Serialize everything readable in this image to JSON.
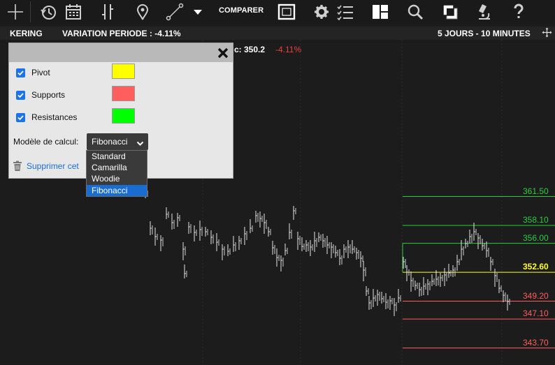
{
  "toolbar": {
    "compare_label": "COMPARER",
    "icons": [
      "crosshair-icon",
      "history-clock-icon",
      "calendar-icon",
      "candlestick-icon",
      "map-pin-icon",
      "trendline-icon",
      "chevron-down-icon",
      "fullscreen-icon",
      "gear-icon",
      "checklist-icon",
      "layout-icon",
      "search-icon",
      "color-contrast-icon",
      "microscope-icon",
      "help-icon"
    ]
  },
  "infobar": {
    "symbol": "KERING",
    "variation": "VARIATION PERIODE : -4.11%",
    "period": "5 JOURS - 10 MINUTES"
  },
  "quote": {
    "price_fragment": "c: 350.2",
    "change": "-4.11%"
  },
  "panel": {
    "rows": [
      {
        "label": "Pivot",
        "checked": true,
        "color": "#ffff00"
      },
      {
        "label": "Supports",
        "checked": true,
        "color": "#ff5e5e"
      },
      {
        "label": "Resistances",
        "checked": true,
        "color": "#00ff00"
      }
    ],
    "model_label": "Modèle de calcul:",
    "model_value": "Fibonacci",
    "delete_label": "Supprimer cet"
  },
  "dropdown": {
    "options": [
      "Standard",
      "Camarilla",
      "Woodie",
      "Fibonacci"
    ],
    "selected": "Fibonacci"
  },
  "levels": [
    {
      "value": "361.50",
      "type": "resistance",
      "color": "#2ecc40"
    },
    {
      "value": "358.10",
      "type": "resistance",
      "color": "#2ecc40"
    },
    {
      "value": "356.00",
      "type": "resistance",
      "color": "#2ecc40"
    },
    {
      "value": "352.60",
      "type": "pivot",
      "color": "#ffff33"
    },
    {
      "value": "349.20",
      "type": "support",
      "color": "#ff5e5e"
    },
    {
      "value": "347.10",
      "type": "support",
      "color": "#ff5e5e"
    },
    {
      "value": "343.70",
      "type": "support",
      "color": "#ff5e5e"
    }
  ]
}
